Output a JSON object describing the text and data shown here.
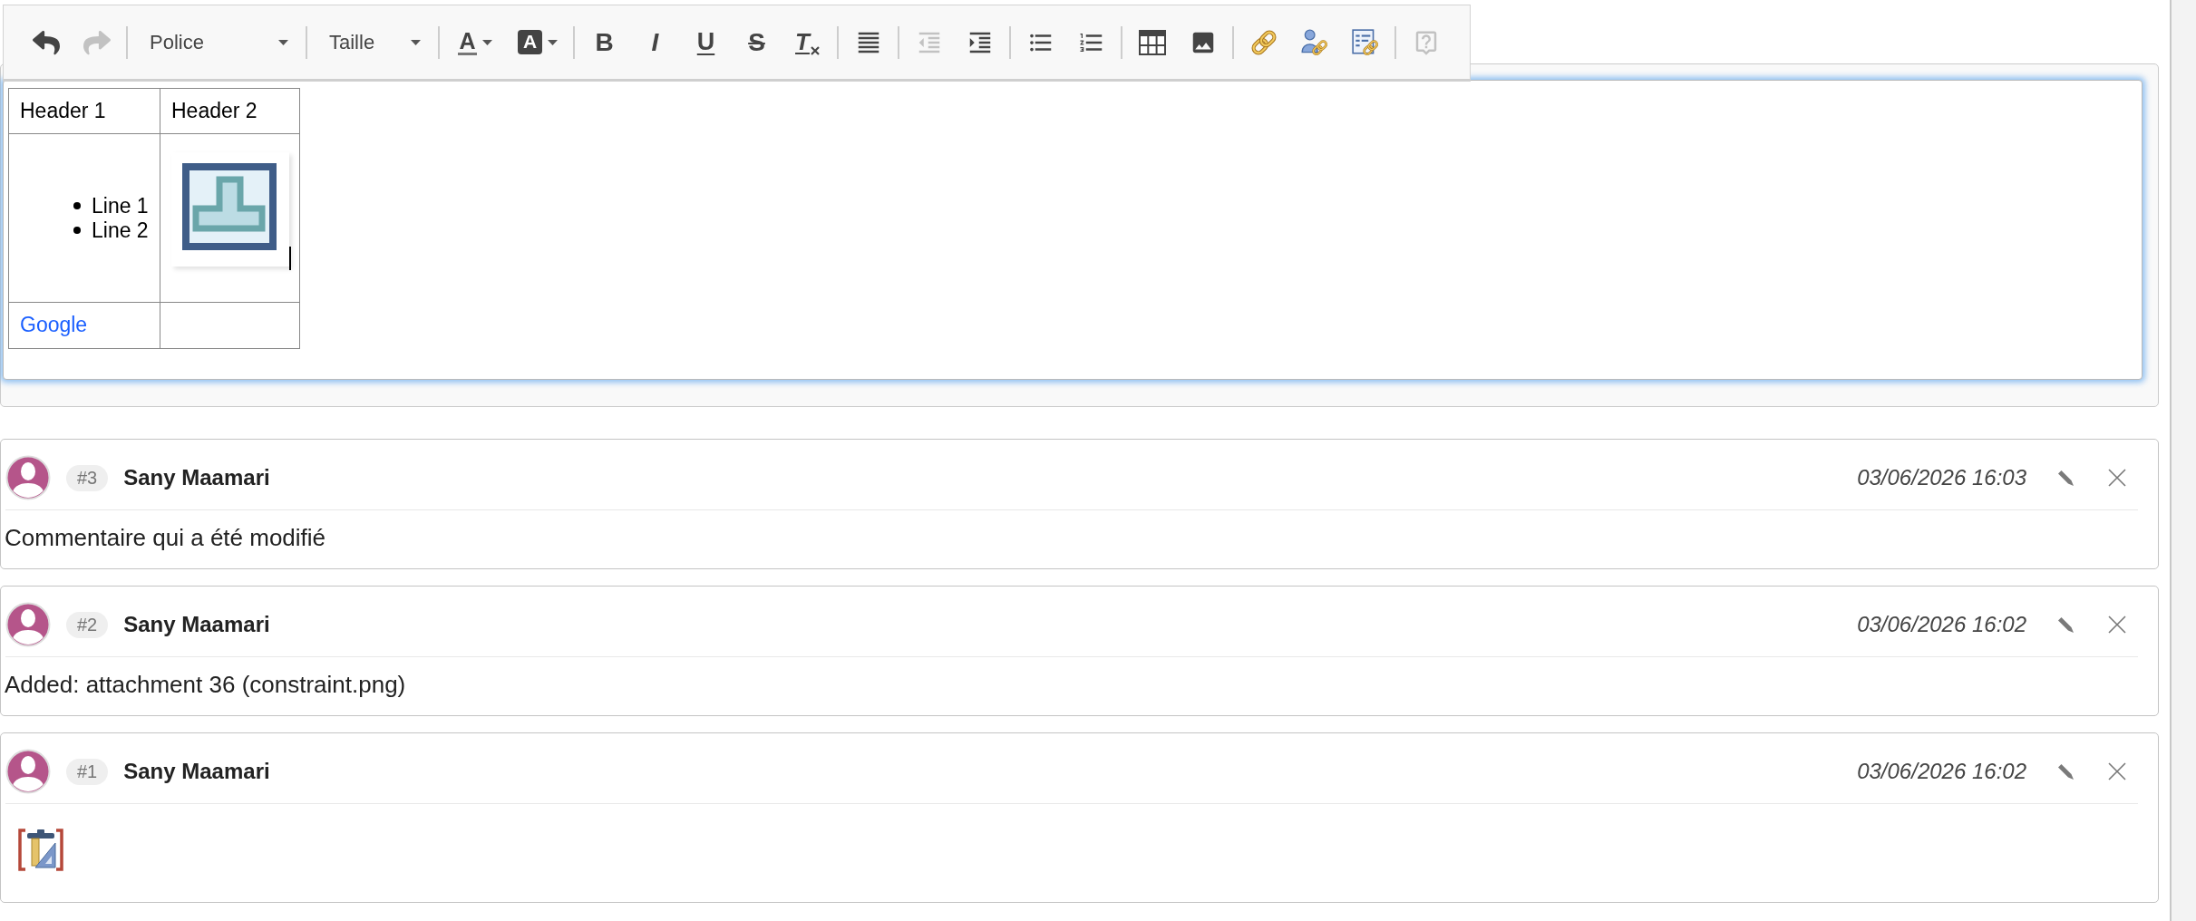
{
  "editor": {
    "focused": true,
    "toolbar": [
      [
        {
          "kind": "undo",
          "disabled": false
        },
        {
          "kind": "redo",
          "disabled": true
        }
      ],
      [
        {
          "kind": "dropdown",
          "label": "Police",
          "disabled": false
        }
      ],
      [
        {
          "kind": "dropdown",
          "label": "Taille",
          "disabled": false
        }
      ],
      [
        {
          "kind": "text-color",
          "glyph": "A",
          "disabled": false
        },
        {
          "kind": "background-color",
          "glyph": "A",
          "disabled": false
        }
      ],
      [
        {
          "kind": "bold",
          "glyph": "B",
          "disabled": false
        },
        {
          "kind": "italic",
          "glyph": "I",
          "disabled": false
        },
        {
          "kind": "underline",
          "glyph": "U",
          "disabled": false
        },
        {
          "kind": "strike",
          "glyph": "S",
          "disabled": false
        },
        {
          "kind": "remove-format",
          "glyph": "T",
          "disabled": false
        }
      ],
      [
        {
          "kind": "justify",
          "disabled": false
        }
      ],
      [
        {
          "kind": "outdent",
          "disabled": true
        },
        {
          "kind": "indent",
          "disabled": false
        }
      ],
      [
        {
          "kind": "bulleted-list",
          "disabled": false
        },
        {
          "kind": "numbered-list",
          "disabled": false
        }
      ],
      [
        {
          "kind": "table",
          "disabled": false
        },
        {
          "kind": "image",
          "disabled": false
        }
      ],
      [
        {
          "kind": "link",
          "disabled": false
        },
        {
          "kind": "user-link",
          "disabled": false
        },
        {
          "kind": "document-link",
          "disabled": false
        }
      ],
      [
        {
          "kind": "help",
          "disabled": true
        }
      ]
    ],
    "content_table": {
      "rows": [
        [
          {
            "kind": "text",
            "text": "Header 1"
          },
          {
            "kind": "text",
            "text": "Header 2"
          }
        ],
        [
          {
            "kind": "list",
            "items": [
              "Line 1",
              "Line 2"
            ]
          },
          {
            "kind": "image",
            "cursor": true
          }
        ],
        [
          {
            "kind": "link",
            "text": "Google"
          },
          {
            "kind": "empty"
          }
        ]
      ]
    }
  },
  "comments": [
    {
      "number": "#3",
      "author": "Sany Maamari",
      "date": "03/06/2026 16:03",
      "body": {
        "kind": "text",
        "text": "Commentaire qui a été modifié"
      }
    },
    {
      "number": "#2",
      "author": "Sany Maamari",
      "date": "03/06/2026 16:02",
      "body": {
        "kind": "text",
        "text": "Added: attachment 36 (constraint.png)"
      }
    },
    {
      "number": "#1",
      "author": "Sany Maamari",
      "date": "03/06/2026 16:02",
      "body": {
        "kind": "image"
      }
    }
  ]
}
